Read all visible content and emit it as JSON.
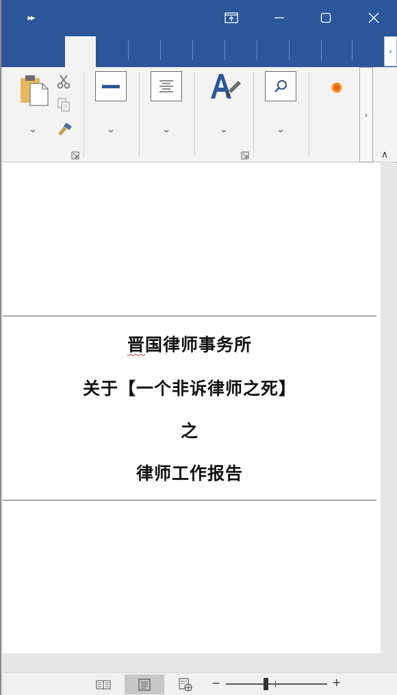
{
  "window": {
    "quick_access_glyph": "▸▸",
    "accent_color": "#2b579a"
  },
  "ribbon": {
    "groups": [
      {
        "name": "clipboard",
        "icons": [
          "paste-icon",
          "cut-icon",
          "copy-icon",
          "format-painter-icon"
        ]
      },
      {
        "name": "font",
        "icons": [
          "font-underline-box-icon"
        ]
      },
      {
        "name": "paragraph",
        "icons": [
          "align-center-icon"
        ]
      },
      {
        "name": "styles",
        "icons": [
          "styles-icon"
        ]
      },
      {
        "name": "editing",
        "icons": [
          "find-icon"
        ]
      },
      {
        "name": "addins",
        "icons": [
          "record-icon"
        ]
      }
    ],
    "scroll_glyph": "›",
    "collapse_glyph": "∧"
  },
  "document": {
    "lines": [
      "晋国律师事务所",
      "关于【一个非诉律师之死】",
      "之",
      "律师工作报告"
    ]
  },
  "statusbar": {
    "zoom_minus": "−",
    "zoom_plus": "+",
    "views": [
      "read-mode",
      "print-layout",
      "web-layout"
    ],
    "active_view": "print-layout"
  }
}
